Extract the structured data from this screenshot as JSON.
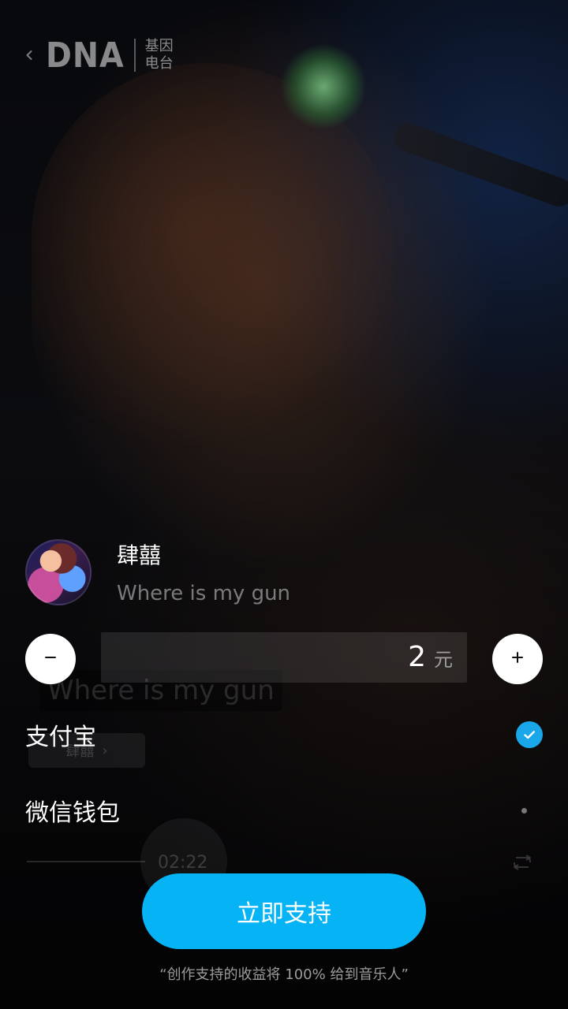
{
  "header": {
    "logo_text": "DNA",
    "subtitle_line1": "基因",
    "subtitle_line2": "电台",
    "icons": {
      "back": "chevron-left-icon"
    }
  },
  "artist": {
    "name": "肆囍",
    "song": "Where is my gun"
  },
  "background_player": {
    "title": "Where is my gun",
    "artist_button": "肆囍",
    "time": "02:22"
  },
  "amount": {
    "value": "2",
    "unit": "元",
    "minus_label": "−",
    "plus_label": "+"
  },
  "payment": {
    "options": [
      {
        "label": "支付宝",
        "selected": true
      },
      {
        "label": "微信钱包",
        "selected": false
      }
    ]
  },
  "cta": {
    "label": "立即支持",
    "note": "“创作支持的收益将 100% 给到音乐人”"
  },
  "colors": {
    "accent": "#06B3F5",
    "check": "#1AA7EA"
  }
}
